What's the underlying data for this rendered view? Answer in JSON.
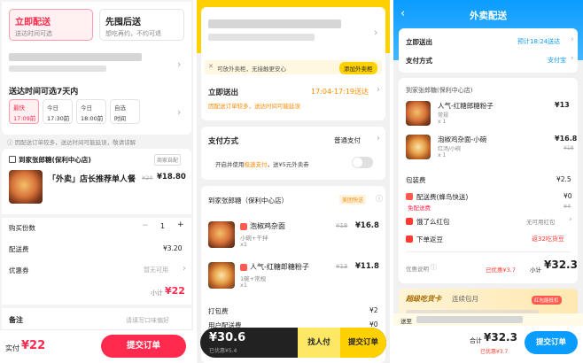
{
  "p1": {
    "opt_now": {
      "title": "立即配送",
      "sub": "送达时间可选"
    },
    "opt_pay": {
      "title": "先囤后送",
      "sub": "想吃再约，不约可退"
    },
    "time_title": "送达时间可选7天内",
    "slots": [
      {
        "line1": "最快",
        "line2": "17:09前"
      },
      {
        "line1": "今日",
        "line2": "17:30前"
      },
      {
        "line1": "今日",
        "line2": "18:00前"
      },
      {
        "line1": "自选",
        "line2": "时间"
      }
    ],
    "notice": "因配送订单较多，送达时间可能延误，敬请谅解",
    "shop": "到家张郎糖(保利中心店)",
    "shop_tag": "商家自配",
    "item_name": "「外卖」店长推荐单人餐",
    "item_old": "¥24",
    "item_price": "¥18.80",
    "qty_label": "购买份数",
    "qty_minus": "−",
    "qty": "1",
    "qty_plus": "+",
    "fee_label": "配送费",
    "fee": "¥3.20",
    "coupon_label": "优惠券",
    "coupon_value": "暂无可用",
    "subtotal_label": "小计",
    "subtotal": "¥22",
    "remark_label": "备注",
    "remark_ph": "请填写口味偏好",
    "pay_label": "实付",
    "pay": "¥22",
    "submit": "提交订单"
  },
  "p2": {
    "notice": "可放外卖柜，无接触更安心",
    "locker_btn": "添加外卖柜",
    "deliver_now": "立即送出",
    "deliver_time": "17:04-17:19送达",
    "deliver_note": "因配送订单较多，送达时间可能延误",
    "pay_method_label": "支付方式",
    "pay_method": "普通支付",
    "quick_pay_pre": "开启并使用",
    "quick_pay_hl": "极速支付",
    "quick_pay_post": "，送¥5元外卖券",
    "shop": "到家张郎糖（保利中心店）",
    "shop_tag": "美团快送",
    "items": [
      {
        "name": "泡椒鸡杂面",
        "spec": "小碗+干拌",
        "qty": "x1",
        "old": "¥18",
        "price": "¥16.8"
      },
      {
        "name": "人气-红糖郎糖粉子",
        "spec": "1碗+常规",
        "qty": "x1",
        "old": "¥13",
        "price": "¥11.8"
      }
    ],
    "pack_label": "打包费",
    "pack": "¥2",
    "user_coupon_label": "用户配送费",
    "user_coupon": "¥0",
    "total": "¥30.6",
    "saved": "已优惠¥5.4",
    "find_pay": "找人付",
    "submit": "提交订单"
  },
  "p3": {
    "title": "外卖配送",
    "deliver_now": "立即送出",
    "deliver_time": "预计18:24送达",
    "pay_method_label": "支付方式",
    "pay_method": "支付宝",
    "shop": "到家张郎糖(保利中心店)",
    "items": [
      {
        "name": "人气-红糖郎糖粉子",
        "spec": "常规",
        "qty": "x 1",
        "price": "¥13"
      },
      {
        "name": "泡椒鸡杂面-小碗",
        "spec": "红汤/小碗",
        "qty": "x 1",
        "price": "¥16.8",
        "old": "¥18"
      }
    ],
    "pack_label": "包装费",
    "pack": "¥2.5",
    "fee_label": "配送费(蜂鸟快送)",
    "fee": "¥0",
    "fee_old": "¥4",
    "fee_sub": "免配送费",
    "red_packet_label": "饿了么红包",
    "red_packet": "无可用红包",
    "return_label": "下单返豆",
    "return_value": "返32吃货豆",
    "discount_label": "优惠说明",
    "discount": "已优惠¥3.7",
    "subtotal_label": "小计",
    "subtotal": "¥32.3",
    "banner": "超级吃货卡",
    "banner_sub": "连续包月",
    "banner_badge": "红包能抵扣",
    "send_to": "送至",
    "total_label": "合计",
    "total": "¥32.3",
    "total_saved": "已优惠¥3.7",
    "submit": "提交订单"
  },
  "colors": {
    "meituan_red": "#ff2a4d",
    "meituan_yellow": "#ffd100",
    "eleme_blue": "#0a9cff",
    "eleme_orange": "#ff5a00"
  }
}
